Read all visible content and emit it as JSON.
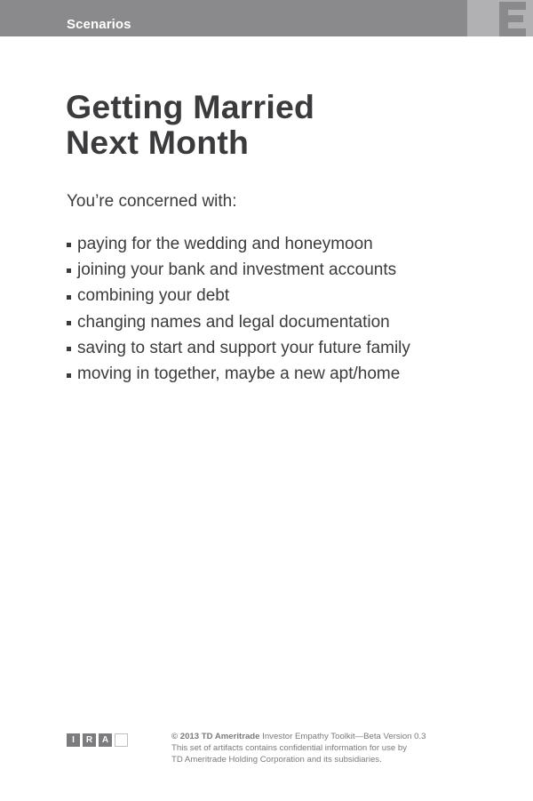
{
  "header": {
    "section_label": "Scenarios",
    "tab_letter": "E"
  },
  "card": {
    "title_line1": "Getting Married",
    "title_line2": "Next Month",
    "intro": "You’re concerned with:",
    "concerns": [
      "paying for the wedding and honeymoon",
      "joining your bank and investment accounts",
      "combining your debt",
      "changing names and legal documentation",
      "saving to start and support your future family",
      "moving in together, maybe a new apt/home"
    ]
  },
  "footer": {
    "tags": [
      "I",
      "R",
      "A",
      ""
    ],
    "copyright": "© 2013 TD Ameritrade",
    "product": " Investor Empathy Toolkit—Beta Version 0.3",
    "legal_line2": "This set of artifacts contains confidential information for use by",
    "legal_line3": "TD Ameritrade Holding Corporation and its subsidiaries."
  },
  "colors": {
    "header_bar": "#8a8a8c",
    "tab_block": "#b1b1b3",
    "text_dark": "#3b3b3d",
    "text_light": "#7a7a7c"
  }
}
